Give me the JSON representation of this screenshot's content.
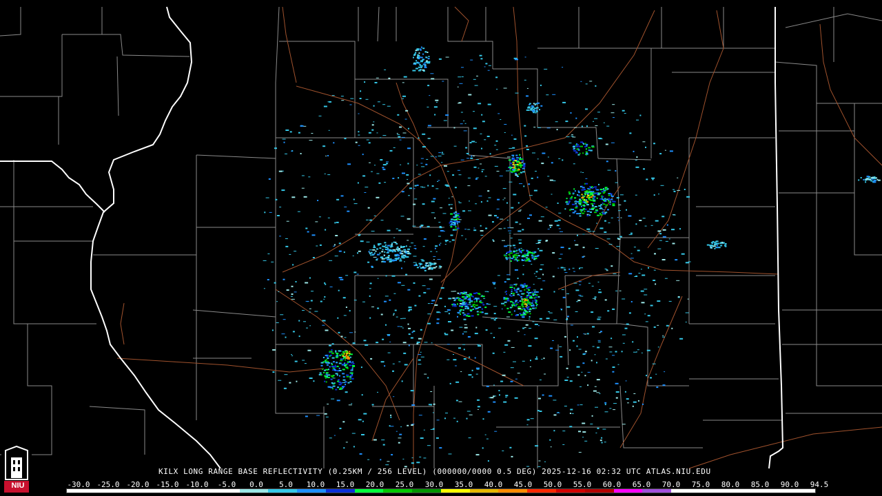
{
  "caption": "KILX LONG RANGE BASE REFLECTIVITY (0.25KM / 256 LEVEL) (000000/0000 0.5 DEG) 2025-12-16 02:32 UTC  ATLAS.NIU.EDU",
  "logo_text": "NIU",
  "scale": {
    "labels": [
      "-30.0",
      "-25.0",
      "-20.0",
      "-15.0",
      "-10.0",
      "-5.0",
      "0.0",
      "5.0",
      "10.0",
      "15.0",
      "20.0",
      "25.0",
      "30.0",
      "35.0",
      "40.0",
      "45.0",
      "50.0",
      "55.0",
      "60.0",
      "65.0",
      "70.0",
      "75.0",
      "80.0",
      "85.0",
      "90.0",
      "94.5"
    ],
    "colors": [
      "#ffffff",
      "#ffffff",
      "#ffffff",
      "#ffffff",
      "#ffffff",
      "#ffffff",
      "#9be6e6",
      "#35c8e8",
      "#1e90ff",
      "#0a2fd8",
      "#00ff3c",
      "#00c800",
      "#009600",
      "#ffff00",
      "#e6b800",
      "#ff8c00",
      "#ff2800",
      "#d20000",
      "#b40000",
      "#ff00ff",
      "#a050dc",
      "#ffffff",
      "#ffffff",
      "#ffffff",
      "#ffffff",
      "#ffffff"
    ]
  },
  "colors": {
    "background": "#000000",
    "county_lines": "#8a8a8a",
    "state_lines": "#ffffff",
    "highways": "#a0522d"
  }
}
